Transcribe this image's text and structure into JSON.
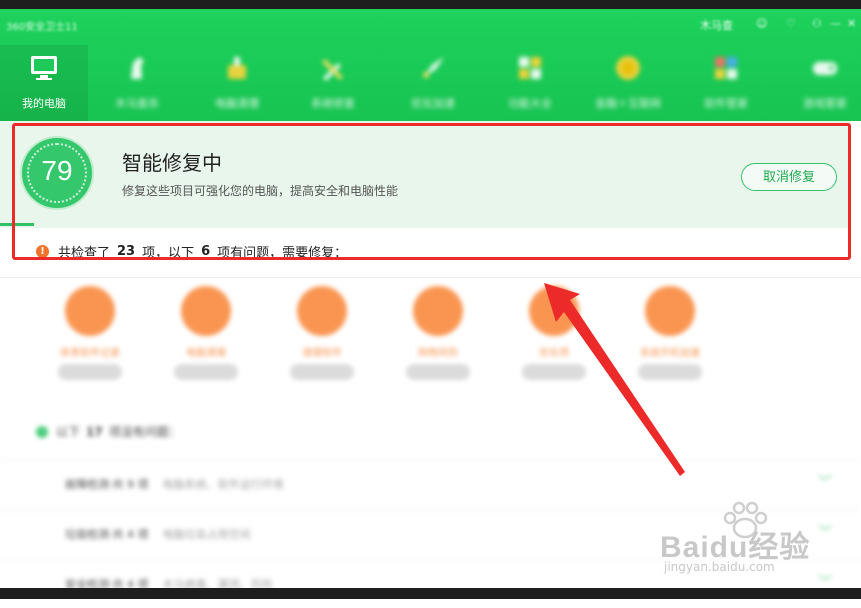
{
  "app": {
    "brand": "360安全卫士11",
    "window_controls": [
      "木马查",
      "☺",
      "♡",
      "⚇",
      "—",
      "✕"
    ]
  },
  "nav": {
    "items": [
      {
        "label": "我的电脑",
        "icon": "monitor-icon",
        "active": true
      },
      {
        "label": "木马查杀",
        "icon": "horse-icon"
      },
      {
        "label": "电脑清理",
        "icon": "broom-icon"
      },
      {
        "label": "系统修复",
        "icon": "tools-icon"
      },
      {
        "label": "优化加速",
        "icon": "rocket-icon"
      },
      {
        "label": "功能大全",
        "icon": "grid-icon"
      },
      {
        "label": "金融＋互联网",
        "icon": "coin-icon"
      },
      {
        "label": "软件管家",
        "icon": "apps-icon"
      },
      {
        "label": "游戏管家",
        "icon": "gamepad-icon"
      }
    ]
  },
  "repair": {
    "score": "79",
    "title": "智能修复中",
    "subtitle": "修复这些项目可强化您的电脑，提高安全和电脑性能",
    "cancel_label": "取消修复",
    "progress": 0.04,
    "summary_prefix": "共检查了",
    "checked_count": "23",
    "summary_mid": "项，以下",
    "problem_count": "6",
    "summary_suffix": "项有问题，需要修复："
  },
  "issues": [
    {
      "label": "体育软件记录",
      "icon": "trash-icon"
    },
    {
      "label": "电脑清理",
      "icon": "clock-icon"
    },
    {
      "label": "清理软件",
      "icon": "gift-icon"
    },
    {
      "label": "购物风险",
      "icon": "cart-icon"
    },
    {
      "label": "优化项",
      "icon": "shield-icon"
    },
    {
      "label": "系统开机加速",
      "icon": "power-icon"
    }
  ],
  "ok_section": {
    "prefix": "以下",
    "count": "17",
    "suffix": "项没有问题："
  },
  "ok_list": [
    {
      "title": "故障检测·共 9 项",
      "desc": "电脑系统、软件运行环境"
    },
    {
      "title": "垃圾检测·共 4 项",
      "desc": "电脑垃圾占用空间"
    },
    {
      "title": "安全检测·共 4 项",
      "desc": "木马病毒、漏洞、风险"
    }
  ],
  "watermark": {
    "main": "Baidu经验",
    "sub": "jingyan.baidu.com"
  },
  "colors": {
    "brand_green": "#17c351",
    "highlight_red": "#ec2a2a",
    "issue_orange": "#f98a3e"
  }
}
